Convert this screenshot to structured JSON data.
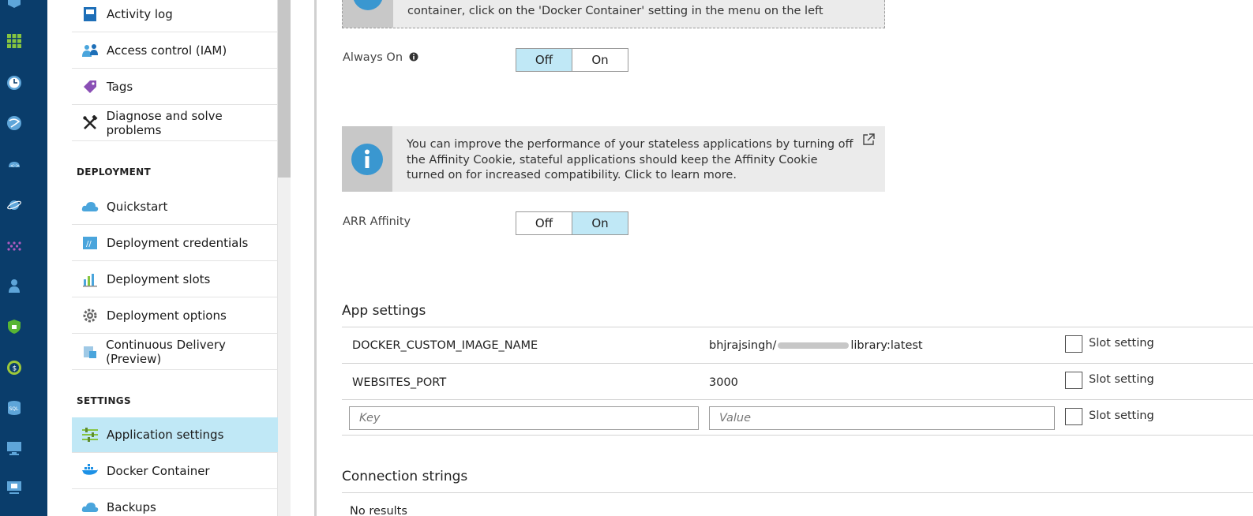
{
  "menu": {
    "items_top": [
      {
        "label": "Activity log",
        "icon": "activity-log-icon"
      },
      {
        "label": "Access control (IAM)",
        "icon": "iam-icon"
      },
      {
        "label": "Tags",
        "icon": "tag-icon"
      },
      {
        "label": "Diagnose and solve problems",
        "icon": "wrench-icon"
      }
    ],
    "deployment_header": "DEPLOYMENT",
    "items_deployment": [
      {
        "label": "Quickstart",
        "icon": "cloud-icon"
      },
      {
        "label": "Deployment credentials",
        "icon": "credentials-icon"
      },
      {
        "label": "Deployment slots",
        "icon": "slots-icon"
      },
      {
        "label": "Deployment options",
        "icon": "gear-icon"
      },
      {
        "label": "Continuous Delivery (Preview)",
        "icon": "delivery-icon"
      }
    ],
    "settings_header": "SETTINGS",
    "items_settings": [
      {
        "label": "Application settings",
        "icon": "app-settings-icon",
        "selected": true
      },
      {
        "label": "Docker Container",
        "icon": "docker-icon"
      },
      {
        "label": "Backups",
        "icon": "backup-icon"
      }
    ]
  },
  "top_notice": {
    "text": "container, click on the 'Docker Container' setting in the menu on the left"
  },
  "always_on": {
    "label": "Always On",
    "off": "Off",
    "on": "On",
    "value": "Off"
  },
  "affinity_notice": {
    "text": "You can improve the performance of your stateless applications by turning off the Affinity Cookie, stateful applications should keep the Affinity Cookie turned on for increased compatibility. Click to learn more."
  },
  "arr_affinity": {
    "label": "ARR Affinity",
    "off": "Off",
    "on": "On",
    "value": "On"
  },
  "app_settings": {
    "title": "App settings",
    "rows": [
      {
        "key": "DOCKER_CUSTOM_IMAGE_NAME",
        "value": "bhjrajsingh/",
        "value_tail": "library:latest",
        "slot_label": "Slot setting"
      },
      {
        "key": "WEBSITES_PORT",
        "value": "3000",
        "slot_label": "Slot setting"
      }
    ],
    "new_row": {
      "key_placeholder": "Key",
      "value_placeholder": "Value",
      "slot_label": "Slot setting"
    }
  },
  "connection_strings": {
    "title": "Connection strings",
    "empty_text": "No results"
  },
  "colors": {
    "rail": "#0a3d6b",
    "selected": "#c0e8f6",
    "info_blue": "#3a97d0"
  }
}
